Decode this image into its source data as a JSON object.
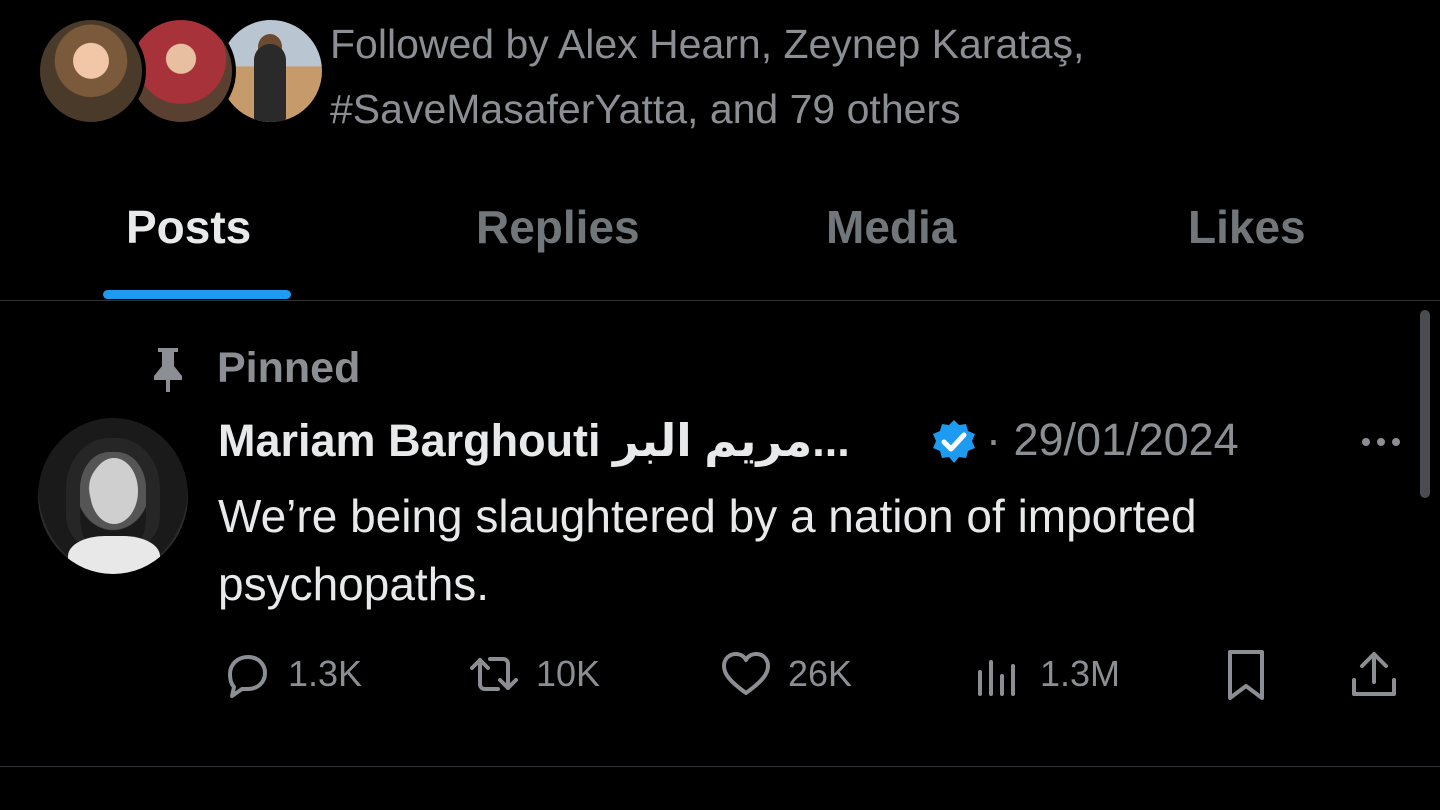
{
  "followers": {
    "text": "Followed by Alex Hearn, Zeynep Karataş, #SaveMasaferYatta, and 79 others"
  },
  "tabs": [
    {
      "label": "Posts",
      "active": true
    },
    {
      "label": "Replies",
      "active": false
    },
    {
      "label": "Media",
      "active": false
    },
    {
      "label": "Likes",
      "active": false
    }
  ],
  "post": {
    "pinned_label": "Pinned",
    "author": "Mariam Barghouti مريم البر...",
    "date": "· 29/01/2024",
    "text": "We’re being slaughtered by a nation of imported psychopaths.",
    "stats": {
      "replies": "1.3K",
      "reposts": "10K",
      "likes": "26K",
      "views": "1.3M"
    }
  },
  "colors": {
    "accent": "#1d9bf0",
    "background": "#000000",
    "muted_text": "#71767b",
    "primary_text": "#e7e9ea"
  },
  "icons": {
    "pin": "pin-icon",
    "verified": "verified-badge-icon",
    "more": "more-dots-icon",
    "reply": "reply-icon",
    "repost": "repost-icon",
    "like": "heart-icon",
    "views": "views-chart-icon",
    "bookmark": "bookmark-icon",
    "share": "share-icon"
  }
}
